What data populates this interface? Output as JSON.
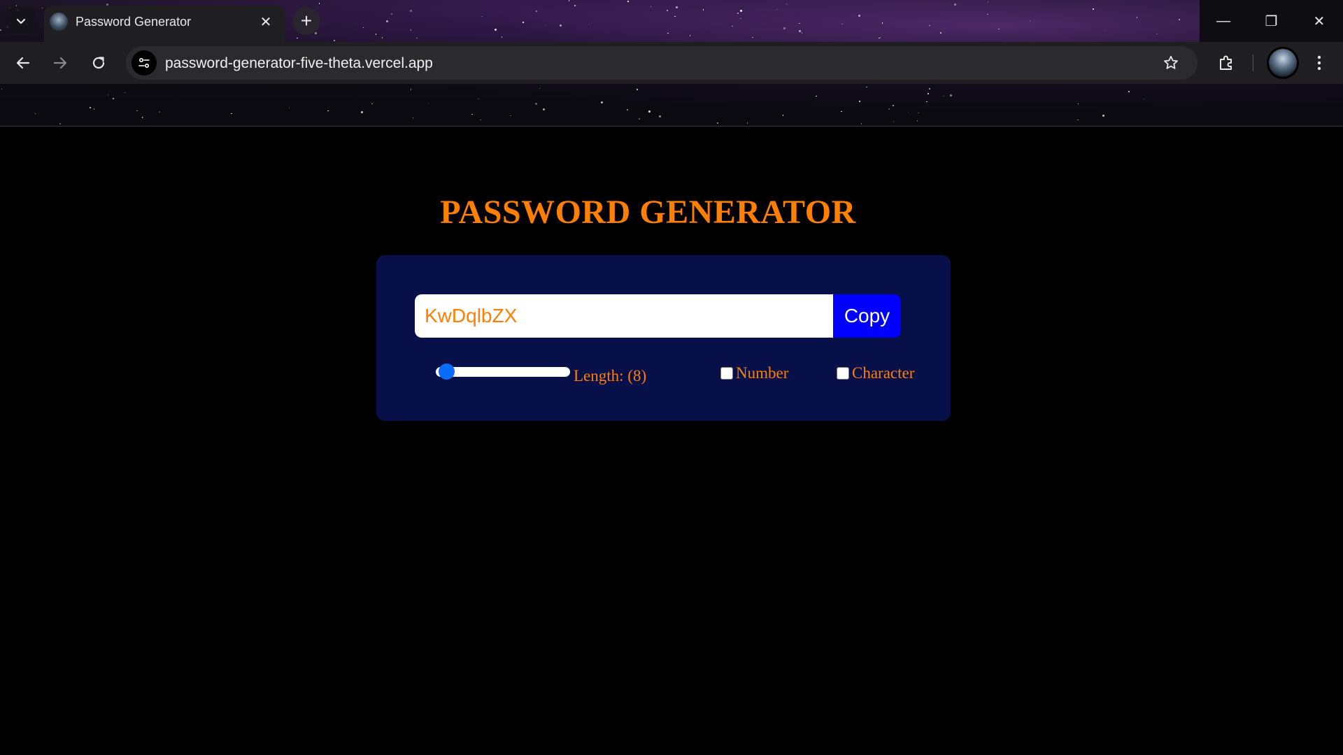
{
  "browser": {
    "tab_title": "Password Generator",
    "tab_close": "✕",
    "new_tab": "+",
    "url": "password-generator-five-theta.vercel.app",
    "window_controls": {
      "minimize": "—",
      "restore": "❐",
      "close": "✕"
    }
  },
  "page": {
    "title": "PASSWORD GENERATOR",
    "password": "KwDqlbZX",
    "copy_label": "Copy",
    "length_label": "Length: (8)",
    "length_value": 8,
    "length_min": 6,
    "length_max": 100,
    "number_label": "Number",
    "number_checked": false,
    "character_label": "Character",
    "character_checked": false
  },
  "colors": {
    "accent_orange": "#ff7f00",
    "card_bg": "#08104a",
    "copy_button": "#0000ff",
    "slider_thumb": "#0a6cff"
  },
  "icons": {
    "tab_search": "chevron-down-icon",
    "back": "arrow-left-icon",
    "forward": "arrow-right-icon",
    "reload": "reload-icon",
    "site_info": "tune-icon",
    "bookmark": "star-icon",
    "extensions": "puzzle-icon",
    "menu": "kebab-menu-icon"
  }
}
